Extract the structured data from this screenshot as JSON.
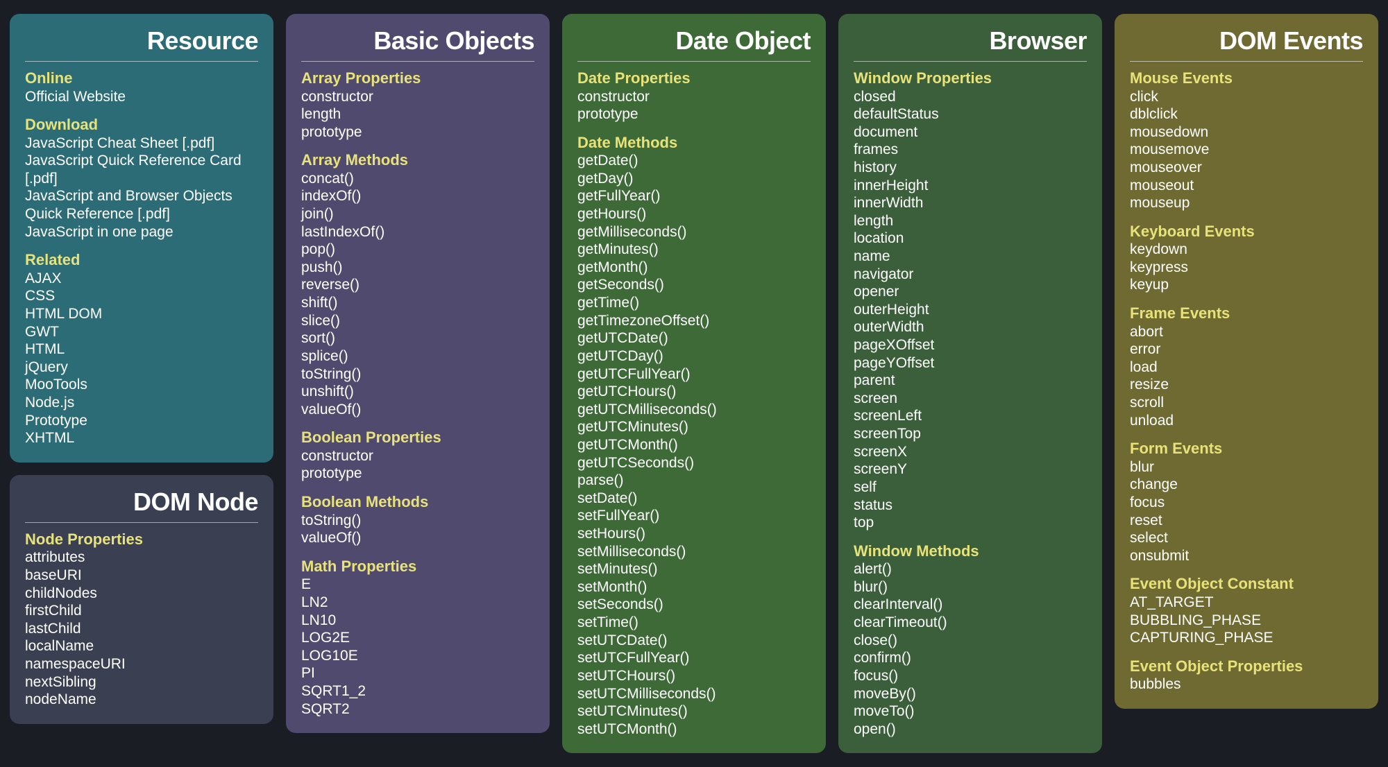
{
  "columns": [
    {
      "cards": [
        {
          "color": "teal",
          "title": "Resource",
          "name": "card-resource",
          "sections": [
            {
              "heading": "Online",
              "items": [
                "Official Website"
              ],
              "links": true
            },
            {
              "heading": "Download",
              "items": [
                "JavaScript Cheat Sheet [.pdf]",
                "JavaScript Quick Reference Card [.pdf]",
                "JavaScript and Browser Objects Quick Reference [.pdf]",
                "JavaScript in one page"
              ],
              "links": true
            },
            {
              "heading": "Related",
              "items": [
                "AJAX",
                "CSS",
                "HTML DOM",
                "GWT",
                "HTML",
                "jQuery",
                "MooTools",
                "Node.js",
                "Prototype",
                "XHTML"
              ],
              "links": true
            }
          ]
        },
        {
          "color": "slate",
          "title": "DOM Node",
          "name": "card-dom-node",
          "sections": [
            {
              "heading": "Node Properties",
              "items": [
                "attributes",
                "baseURI",
                "childNodes",
                "firstChild",
                "lastChild",
                "localName",
                "namespaceURI",
                "nextSibling",
                "nodeName"
              ]
            }
          ]
        }
      ]
    },
    {
      "cards": [
        {
          "color": "purple",
          "title": "Basic Objects",
          "name": "card-basic-objects",
          "sections": [
            {
              "heading": "Array Properties",
              "items": [
                "constructor",
                "length",
                "prototype"
              ]
            },
            {
              "heading": "Array Methods",
              "items": [
                "concat()",
                "indexOf()",
                "join()",
                "lastIndexOf()",
                "pop()",
                "push()",
                "reverse()",
                "shift()",
                "slice()",
                "sort()",
                "splice()",
                "toString()",
                "unshift()",
                "valueOf()"
              ]
            },
            {
              "heading": "Boolean Properties",
              "items": [
                "constructor",
                "prototype"
              ]
            },
            {
              "heading": "Boolean Methods",
              "items": [
                "toString()",
                "valueOf()"
              ]
            },
            {
              "heading": "Math Properties",
              "items": [
                "E",
                "LN2",
                "LN10",
                "LOG2E",
                "LOG10E",
                "PI",
                "SQRT1_2",
                "SQRT2"
              ]
            }
          ]
        }
      ]
    },
    {
      "cards": [
        {
          "color": "green",
          "title": "Date Object",
          "name": "card-date-object",
          "sections": [
            {
              "heading": "Date Properties",
              "items": [
                "constructor",
                "prototype"
              ]
            },
            {
              "heading": "Date Methods",
              "items": [
                "getDate()",
                "getDay()",
                "getFullYear()",
                "getHours()",
                "getMilliseconds()",
                "getMinutes()",
                "getMonth()",
                "getSeconds()",
                "getTime()",
                "getTimezoneOffset()",
                "getUTCDate()",
                "getUTCDay()",
                "getUTCFullYear()",
                "getUTCHours()",
                "getUTCMilliseconds()",
                "getUTCMinutes()",
                "getUTCMonth()",
                "getUTCSeconds()",
                "parse()",
                "setDate()",
                "setFullYear()",
                "setHours()",
                "setMilliseconds()",
                "setMinutes()",
                "setMonth()",
                "setSeconds()",
                "setTime()",
                "setUTCDate()",
                "setUTCFullYear()",
                "setUTCHours()",
                "setUTCMilliseconds()",
                "setUTCMinutes()",
                "setUTCMonth()"
              ]
            }
          ]
        }
      ]
    },
    {
      "cards": [
        {
          "color": "greendk",
          "title": "Browser",
          "name": "card-browser",
          "sections": [
            {
              "heading": "Window Properties",
              "items": [
                "closed",
                "defaultStatus",
                "document",
                "frames",
                "history",
                "innerHeight",
                "innerWidth",
                "length",
                "location",
                "name",
                "navigator",
                "opener",
                "outerHeight",
                "outerWidth",
                "pageXOffset",
                "pageYOffset",
                "parent",
                "screen",
                "screenLeft",
                "screenTop",
                "screenX",
                "screenY",
                "self",
                "status",
                "top"
              ]
            },
            {
              "heading": "Window Methods",
              "items": [
                "alert()",
                "blur()",
                "clearInterval()",
                "clearTimeout()",
                "close()",
                "confirm()",
                "focus()",
                "moveBy()",
                "moveTo()",
                "open()"
              ]
            }
          ]
        }
      ]
    },
    {
      "cards": [
        {
          "color": "olive",
          "title": "DOM Events",
          "name": "card-dom-events",
          "sections": [
            {
              "heading": "Mouse Events",
              "items": [
                "click",
                "dblclick",
                "mousedown",
                "mousemove",
                "mouseover",
                "mouseout",
                "mouseup"
              ]
            },
            {
              "heading": "Keyboard Events",
              "items": [
                "keydown",
                "keypress",
                "keyup"
              ]
            },
            {
              "heading": "Frame Events",
              "items": [
                "abort",
                "error",
                "load",
                "resize",
                "scroll",
                "unload"
              ]
            },
            {
              "heading": "Form Events",
              "items": [
                "blur",
                "change",
                "focus",
                "reset",
                "select",
                "onsubmit"
              ]
            },
            {
              "heading": "Event Object Constant",
              "items": [
                "AT_TARGET",
                "BUBBLING_PHASE",
                "CAPTURING_PHASE"
              ]
            },
            {
              "heading": "Event Object Properties",
              "items": [
                "bubbles"
              ]
            }
          ]
        }
      ]
    }
  ]
}
